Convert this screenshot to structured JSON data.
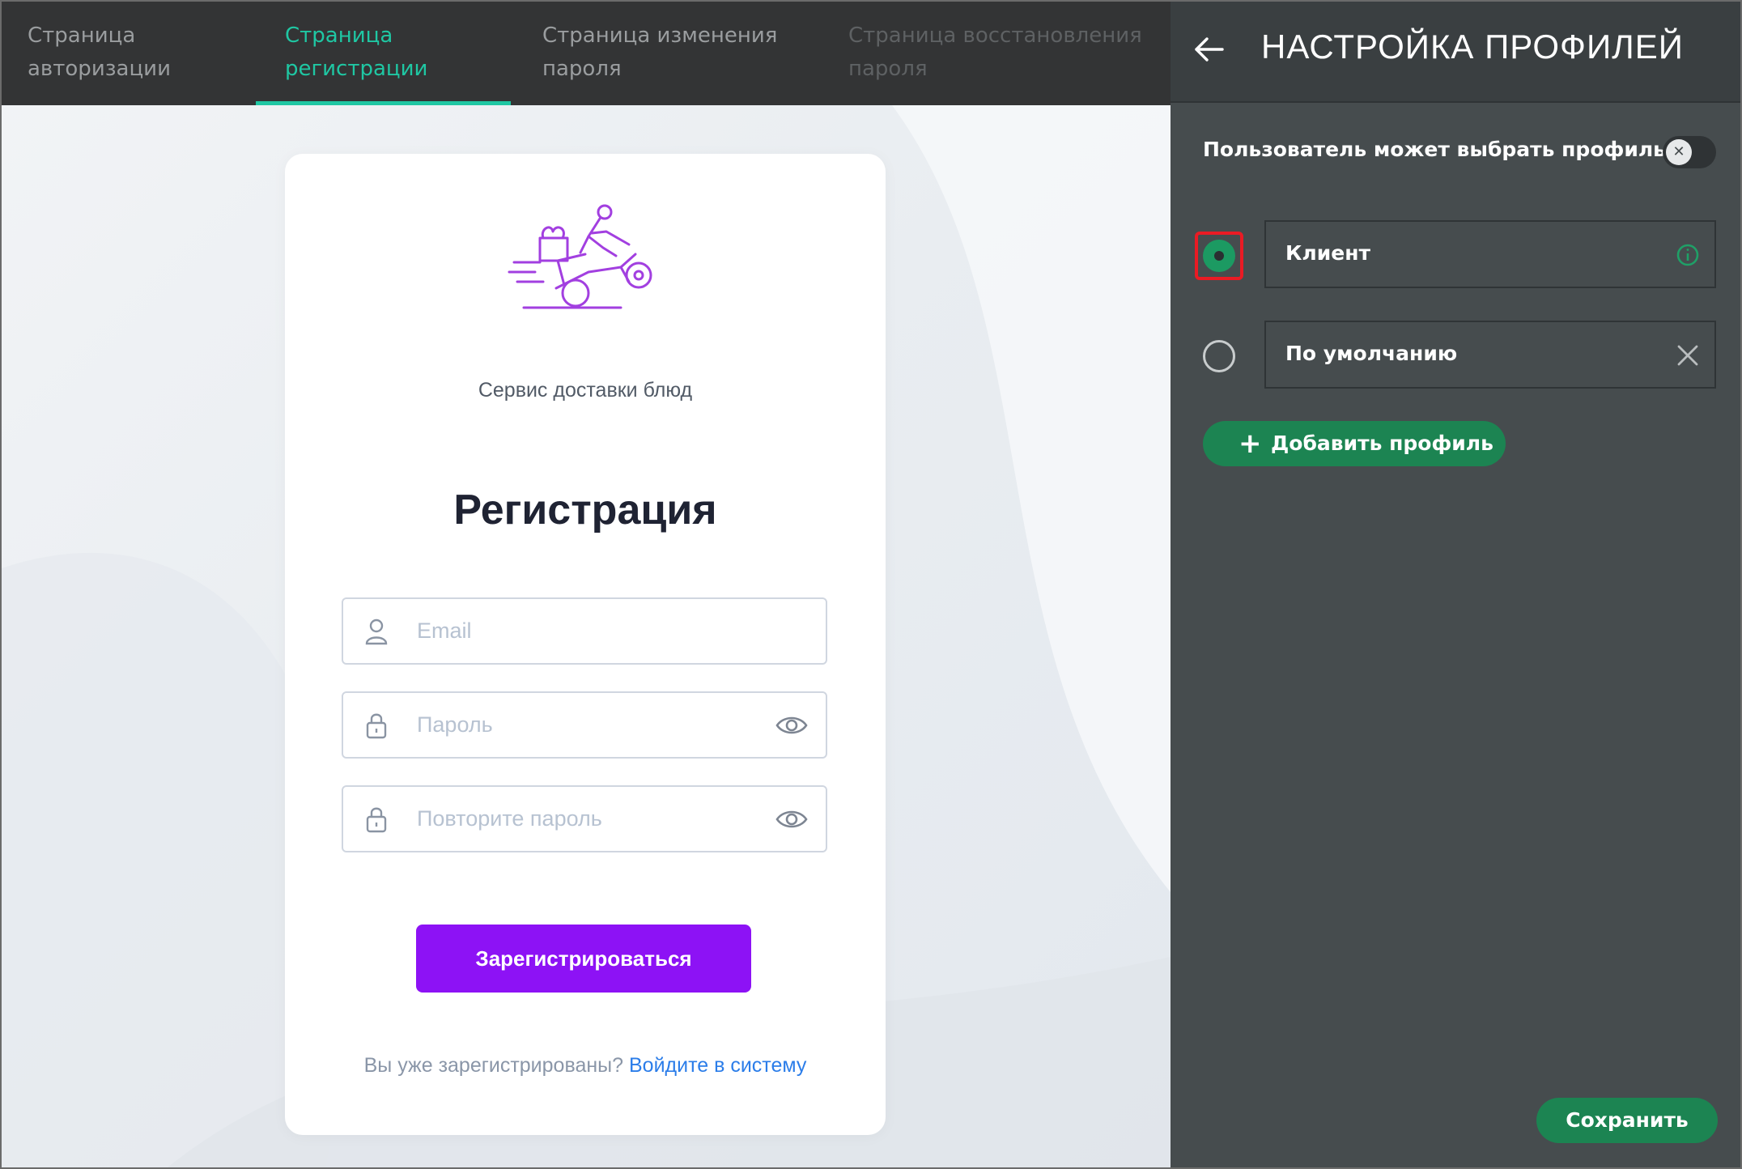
{
  "tabs": [
    {
      "line1": "Страница",
      "line2": "авторизации"
    },
    {
      "line1": "Страница",
      "line2": "регистрации"
    },
    {
      "line1": "Страница изменения",
      "line2": "пароля"
    },
    {
      "line1": "Страница восстановления",
      "line2": "пароля"
    }
  ],
  "active_tab": 1,
  "registration": {
    "service_name": "Сервис доставки блюд",
    "title": "Регистрация",
    "email_placeholder": "Email",
    "password_placeholder": "Пароль",
    "repeat_password_placeholder": "Повторите пароль",
    "submit_label": "Зарегистрироваться",
    "already_registered": "Вы уже зарегистрированы?",
    "login_link": "Войдите в систему"
  },
  "panel": {
    "title": "НАСТРОЙКА ПРОФИЛЕЙ",
    "toggle_label": "Пользователь может выбрать профиль",
    "toggle_on": false,
    "profiles": [
      {
        "name": "Клиент",
        "selected": true,
        "icon": "info-icon"
      },
      {
        "name": "По умолчанию",
        "selected": false,
        "icon": "close-icon"
      }
    ],
    "add_profile_label": "Добавить профиль",
    "save_label": "Сохранить"
  },
  "colors": {
    "accent_teal": "#1fc7a3",
    "button_purple": "#8d12f5",
    "panel_green": "#1c8452",
    "highlight_red": "#ea1b24",
    "illustration_purple": "#a23fe0"
  }
}
